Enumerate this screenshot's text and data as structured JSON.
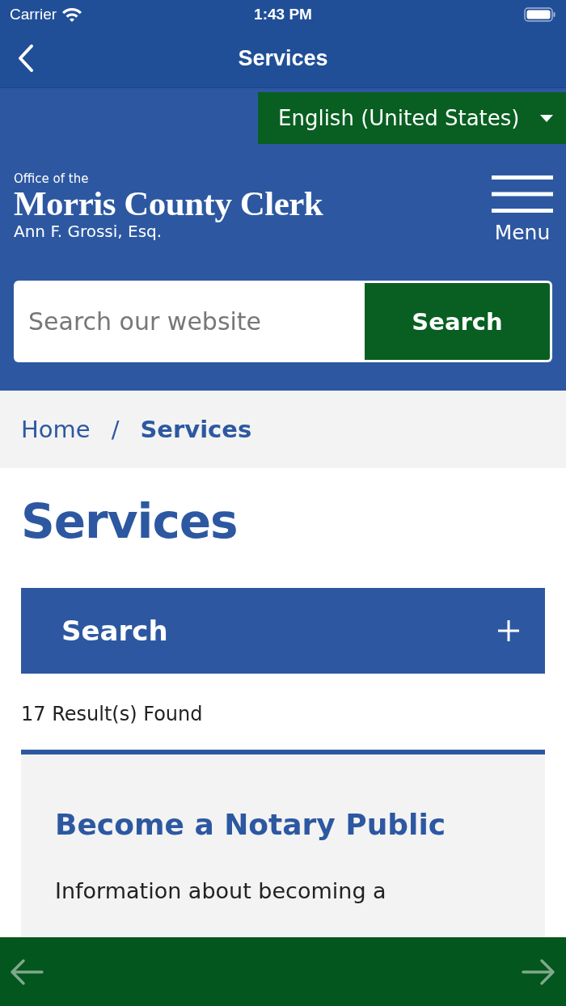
{
  "status_bar": {
    "carrier": "Carrier",
    "time": "1:43 PM"
  },
  "nav": {
    "title": "Services"
  },
  "language": {
    "label": "English (United States)"
  },
  "site": {
    "kicker": "Office of the",
    "name": "Morris County Clerk",
    "subtitle": "Ann F. Grossi, Esq.",
    "menu_label": "Menu"
  },
  "search": {
    "placeholder": "Search our website",
    "button": "Search"
  },
  "breadcrumb": [
    {
      "label": "Home",
      "current": false
    },
    {
      "label": "Services",
      "current": true
    }
  ],
  "breadcrumb_separator": "/",
  "page_title": "Services",
  "accordion": {
    "label": "Search",
    "expanded": false
  },
  "results": "17 Result(s) Found",
  "cards": [
    {
      "title": "Become a Notary Public",
      "text": "Information about becoming a"
    }
  ],
  "bottom_bar": {
    "back_disabled": true,
    "forward_disabled": true
  }
}
